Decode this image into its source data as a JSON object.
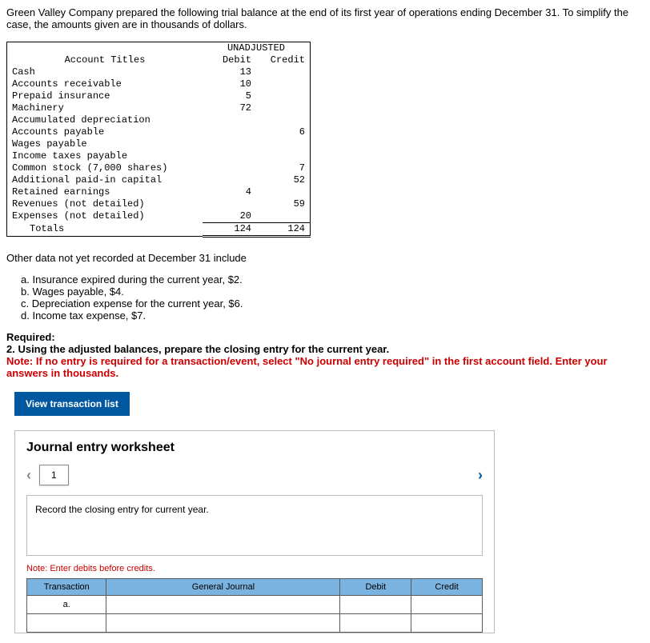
{
  "intro": "Green Valley Company prepared the following trial balance at the end of its first year of operations ending December 31. To simplify the case, the amounts given are in thousands of dollars.",
  "tb": {
    "unadj": "UNADJUSTED",
    "acct_titles": "Account Titles",
    "debit": "Debit",
    "credit": "Credit",
    "rows": [
      {
        "a": "Cash",
        "d": "13",
        "c": ""
      },
      {
        "a": "Accounts receivable",
        "d": "10",
        "c": ""
      },
      {
        "a": "Prepaid insurance",
        "d": "5",
        "c": ""
      },
      {
        "a": "Machinery",
        "d": "72",
        "c": ""
      },
      {
        "a": "Accumulated depreciation",
        "d": "",
        "c": ""
      },
      {
        "a": "Accounts payable",
        "d": "",
        "c": "6"
      },
      {
        "a": "Wages payable",
        "d": "",
        "c": ""
      },
      {
        "a": "Income taxes payable",
        "d": "",
        "c": ""
      },
      {
        "a": "Common stock (7,000 shares)",
        "d": "",
        "c": "7"
      },
      {
        "a": "Additional paid-in capital",
        "d": "",
        "c": "52"
      },
      {
        "a": "Retained earnings",
        "d": "4",
        "c": ""
      },
      {
        "a": "Revenues (not detailed)",
        "d": "",
        "c": "59"
      },
      {
        "a": "Expenses (not detailed)",
        "d": "20",
        "c": ""
      }
    ],
    "totals_label": "Totals",
    "totals_d": "124",
    "totals_c": "124"
  },
  "other_label": "Other data not yet recorded at December 31 include",
  "letters": {
    "a": "a. Insurance expired during the current year, $2.",
    "b": "b. Wages payable, $4.",
    "c": "c. Depreciation expense for the current year, $6.",
    "d": "d. Income tax expense, $7."
  },
  "required": {
    "head": "Required:",
    "line": "2. Using the adjusted balances, prepare the closing entry for the current year.",
    "note": "Note: If no entry is required for a transaction/event, select \"No journal entry required\" in the first account field. Enter your answers in thousands."
  },
  "view_btn": "View transaction list",
  "ws": {
    "title": "Journal entry worksheet",
    "tab": "1",
    "record": "Record the closing entry for current year.",
    "note": "Note: Enter debits before credits.",
    "th_tx": "Transaction",
    "th_gj": "General Journal",
    "th_d": "Debit",
    "th_c": "Credit",
    "row_a": "a."
  },
  "chart_data": {
    "type": "table",
    "title": "Unadjusted Trial Balance (thousands)",
    "columns": [
      "Account",
      "Debit",
      "Credit"
    ],
    "rows": [
      [
        "Cash",
        13,
        null
      ],
      [
        "Accounts receivable",
        10,
        null
      ],
      [
        "Prepaid insurance",
        5,
        null
      ],
      [
        "Machinery",
        72,
        null
      ],
      [
        "Accumulated depreciation",
        null,
        null
      ],
      [
        "Accounts payable",
        null,
        6
      ],
      [
        "Wages payable",
        null,
        null
      ],
      [
        "Income taxes payable",
        null,
        null
      ],
      [
        "Common stock (7,000 shares)",
        null,
        7
      ],
      [
        "Additional paid-in capital",
        null,
        52
      ],
      [
        "Retained earnings",
        4,
        null
      ],
      [
        "Revenues (not detailed)",
        null,
        59
      ],
      [
        "Expenses (not detailed)",
        20,
        null
      ],
      [
        "Totals",
        124,
        124
      ]
    ]
  }
}
